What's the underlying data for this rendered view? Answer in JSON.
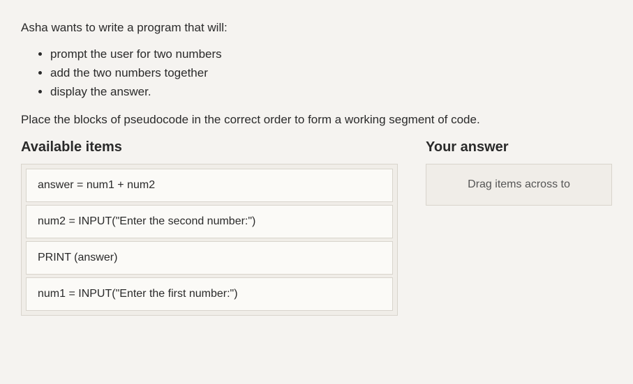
{
  "intro": "Asha wants to write a program that will:",
  "requirements": [
    "prompt the user for two numbers",
    "add the two numbers together",
    "display the answer."
  ],
  "instruction": "Place the blocks of pseudocode in the correct order to form a working segment of code.",
  "available": {
    "title": "Available items",
    "items": [
      "answer = num1 + num2",
      "num2 = INPUT(\"Enter the second number:\")",
      "PRINT (answer)",
      "num1 = INPUT(\"Enter the first number:\")"
    ]
  },
  "answer": {
    "title": "Your answer",
    "placeholder": "Drag items across to"
  }
}
